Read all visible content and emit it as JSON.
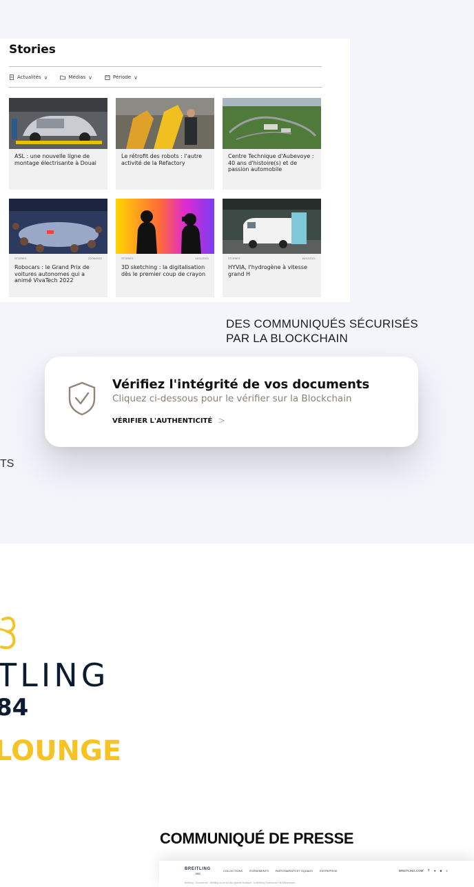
{
  "stories": {
    "title": "Stories",
    "filters": [
      {
        "icon": "document-icon",
        "label": "Actualités"
      },
      {
        "icon": "folder-icon",
        "label": "Médias"
      },
      {
        "icon": "calendar-icon",
        "label": "Période"
      }
    ],
    "cards": [
      {
        "text": "ASL : une nouvelle ligne de montage électrisante à Douai",
        "category": "",
        "date": ""
      },
      {
        "text": "Le rétrofit des robots : l'autre activité de la Refactory",
        "category": "",
        "date": ""
      },
      {
        "text": "Centre Technique d'Aubevoye : 40 ans d'histoire(s) et de passion automobile",
        "category": "",
        "date": ""
      },
      {
        "text": "Robocars : le Grand Prix de voitures autonomes qui a animé VivaTech 2022",
        "category": "STORIES",
        "date": "22/06/2022"
      },
      {
        "text": "3D sketching : la digitalisation dès le premier coup de crayon",
        "category": "STORIES",
        "date": "18/11/2021"
      },
      {
        "text": "HYVIA, l'hydrogène à vitesse grand H",
        "category": "STORIES",
        "date": "16/12/2021"
      }
    ]
  },
  "blockchain": {
    "heading_line1": "DES COMMUNIQUÉS SÉCURISÉS",
    "heading_line2": "PAR LA BLOCKCHAIN"
  },
  "verify": {
    "title": "Vérifiez l'intégrité de vos documents",
    "subtitle": "Cliquez ci-dessous pour le vérifier sur la Blockchain",
    "link_label": "VÉRIFIER L'AUTHENTICITÉ",
    "arrow": ">"
  },
  "fragment": {
    "text": "TS"
  },
  "logo": {
    "name": "TLING",
    "year": "84",
    "lounge": "LOUNGE"
  },
  "press": {
    "heading": "COMMUNIQUÉ DE PRESSE",
    "preview": {
      "logo": "BREITLING",
      "logo_year": "1884",
      "nav": [
        "COLLECTIONS",
        "ÉVÉNEMENTS",
        "PARTENARIATS ET SQUADS",
        "ENTREPRISE"
      ],
      "right_link": "BREITLING.COM",
      "breadcrumb": "Breitling · Documents · Breitling ouvre sa plus grande boutique : la Breitling Townhouse Hill Manchester..."
    }
  },
  "colors": {
    "band": "#f4f5fb",
    "accent_gold": "#f6c324",
    "navy": "#0c1c30",
    "subtitle_taupe": "#8a7f74"
  }
}
